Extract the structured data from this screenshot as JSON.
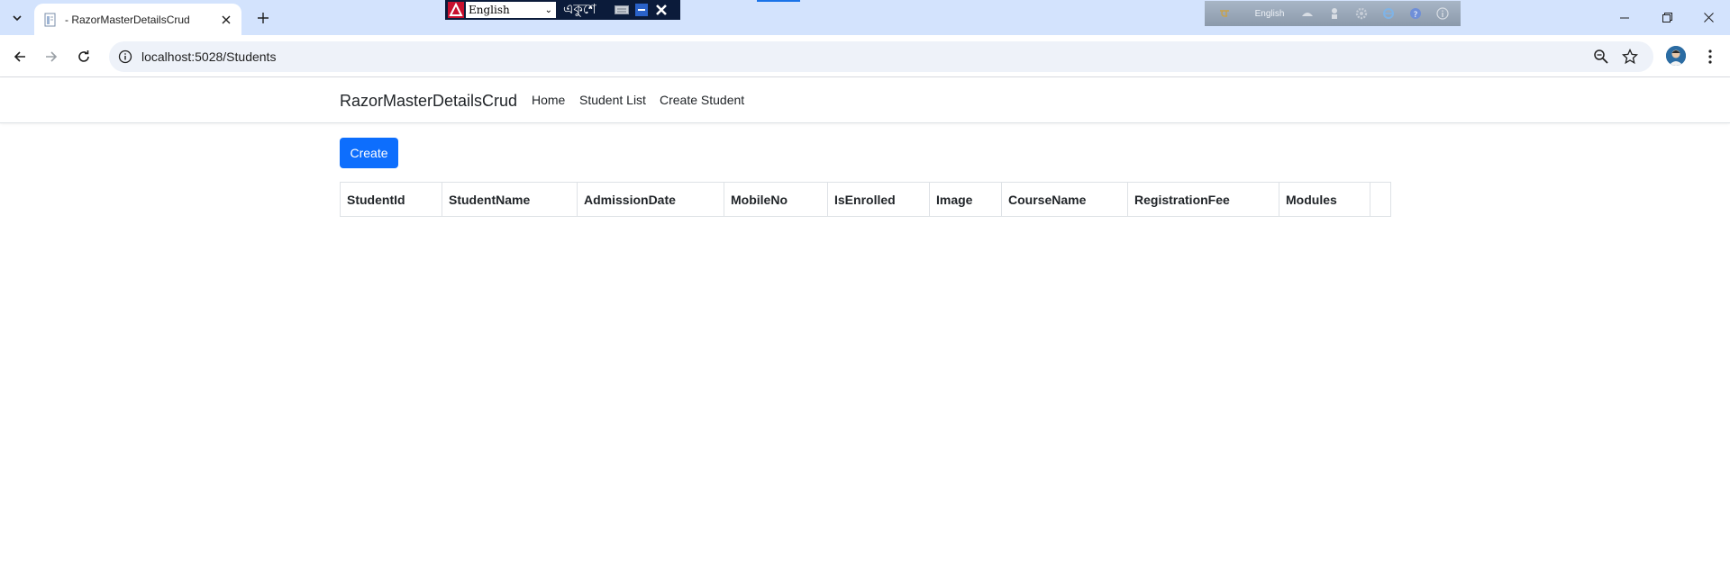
{
  "browser": {
    "tab_title": "- RazorMasterDetailsCrud",
    "url": "localhost:5028/Students"
  },
  "ime": {
    "language": "English",
    "bangla_label": "একুশে",
    "toolbar_language": "English"
  },
  "site": {
    "brand": "RazorMasterDetailsCrud",
    "nav": [
      "Home",
      "Student List",
      "Create Student"
    ],
    "create_label": "Create"
  },
  "table": {
    "columns": [
      "StudentId",
      "StudentName",
      "AdmissionDate",
      "MobileNo",
      "IsEnrolled",
      "Image",
      "CourseName",
      "RegistrationFee",
      "Modules",
      ""
    ]
  },
  "colors": {
    "tabstrip": "#d3e3fd",
    "primary_button": "#0d6efd",
    "table_border": "#dee2e6"
  }
}
